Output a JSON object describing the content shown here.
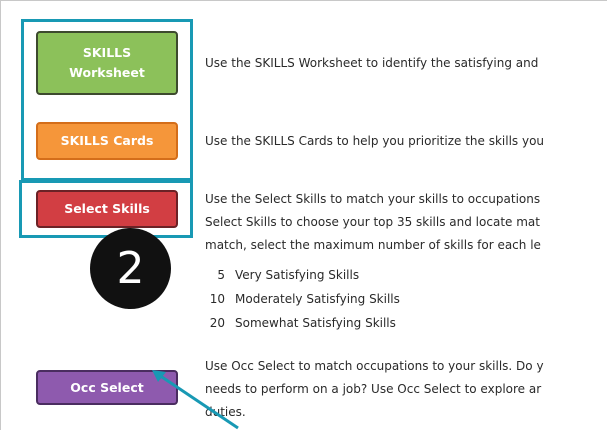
{
  "buttons": {
    "skills_worksheet": [
      "SKILLS",
      "Worksheet"
    ],
    "skills_cards": "SKILLS Cards",
    "select_skills": "Select Skills",
    "occ_select": "Occ Select"
  },
  "badge": "2",
  "descriptions": {
    "worksheet": "Use the SKILLS Worksheet to identify the satisfying and",
    "cards": "Use the SKILLS Cards to help you prioritize the skills you",
    "select": [
      "Use the Select Skills to match your skills to occupations",
      "Select Skills to choose your top 35 skills and locate mat",
      "match, select the maximum number of skills for each le"
    ],
    "occ": [
      "Use Occ Select to match occupations to your skills. Do y",
      "needs to perform on a job? Use Occ Select to explore ar",
      "duties."
    ]
  },
  "skill_levels": [
    {
      "count": "5",
      "label": "Very Satisfying Skills"
    },
    {
      "count": "10",
      "label": "Moderately Satisfying Skills"
    },
    {
      "count": "20",
      "label": "Somewhat Satisfying Skills"
    }
  ],
  "colors": {
    "highlight": "#1899b4",
    "skills_worksheet": "#8cc15a",
    "skills_cards": "#f5963a",
    "select_skills": "#d23e43",
    "occ_select": "#8e5aae"
  }
}
